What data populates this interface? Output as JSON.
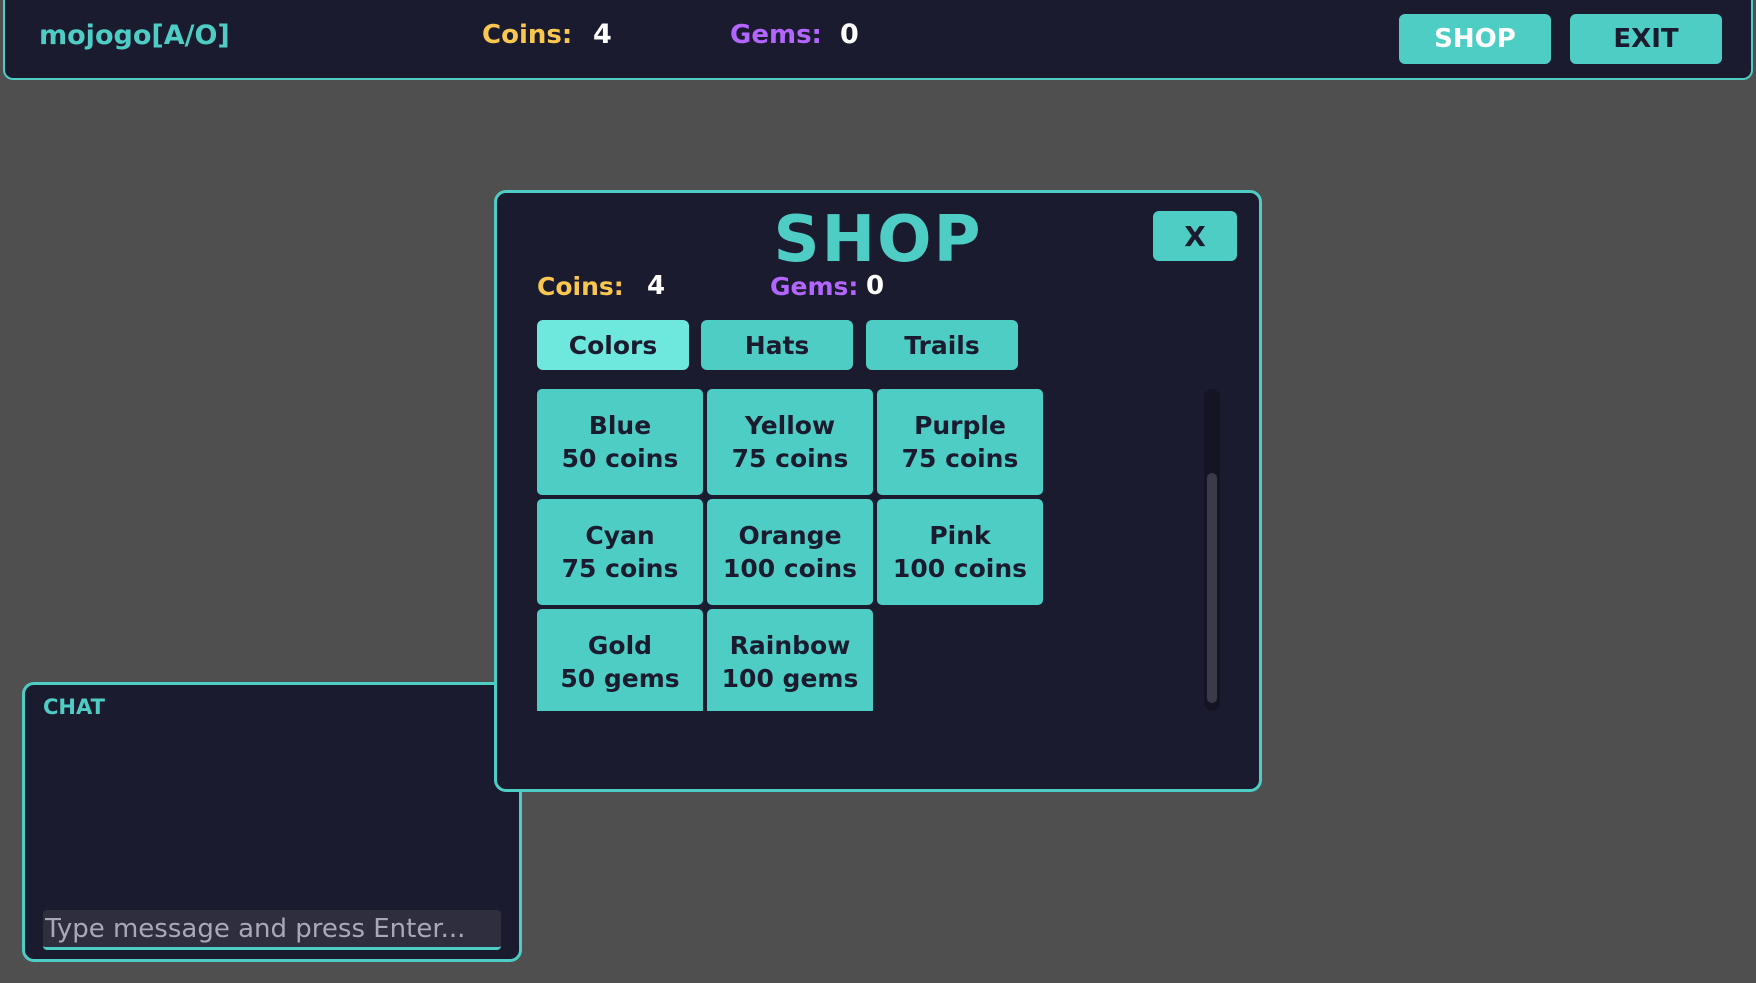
{
  "topbar": {
    "player_name": "mojogo[A/O]",
    "coins_label": "Coins:",
    "coins_value": "4",
    "gems_label": "Gems:",
    "gems_value": "0",
    "shop_button": "SHOP",
    "exit_button": "EXIT"
  },
  "shop": {
    "title": "SHOP",
    "close_label": "X",
    "coins_label": "Coins:",
    "coins_value": "4",
    "gems_label": "Gems:",
    "gems_value": "0",
    "tabs": [
      {
        "label": "Colors",
        "active": true
      },
      {
        "label": "Hats",
        "active": false
      },
      {
        "label": "Trails",
        "active": false
      }
    ],
    "items": [
      {
        "name": "Blue",
        "price": "50 coins"
      },
      {
        "name": "Yellow",
        "price": "75 coins"
      },
      {
        "name": "Purple",
        "price": "75 coins"
      },
      {
        "name": "Cyan",
        "price": "75 coins"
      },
      {
        "name": "Orange",
        "price": "100 coins"
      },
      {
        "name": "Pink",
        "price": "100 coins"
      },
      {
        "name": "Gold",
        "price": "50 gems"
      },
      {
        "name": "Rainbow",
        "price": "100 gems"
      }
    ]
  },
  "chat": {
    "title": "CHAT",
    "input_placeholder": "Type message and press Enter...",
    "input_value": ""
  },
  "colors": {
    "accent": "#4ecdc4",
    "panel": "#1b1b2f",
    "coins": "#f9c74f",
    "gems": "#b266ff",
    "background": "#4f4f4f"
  }
}
